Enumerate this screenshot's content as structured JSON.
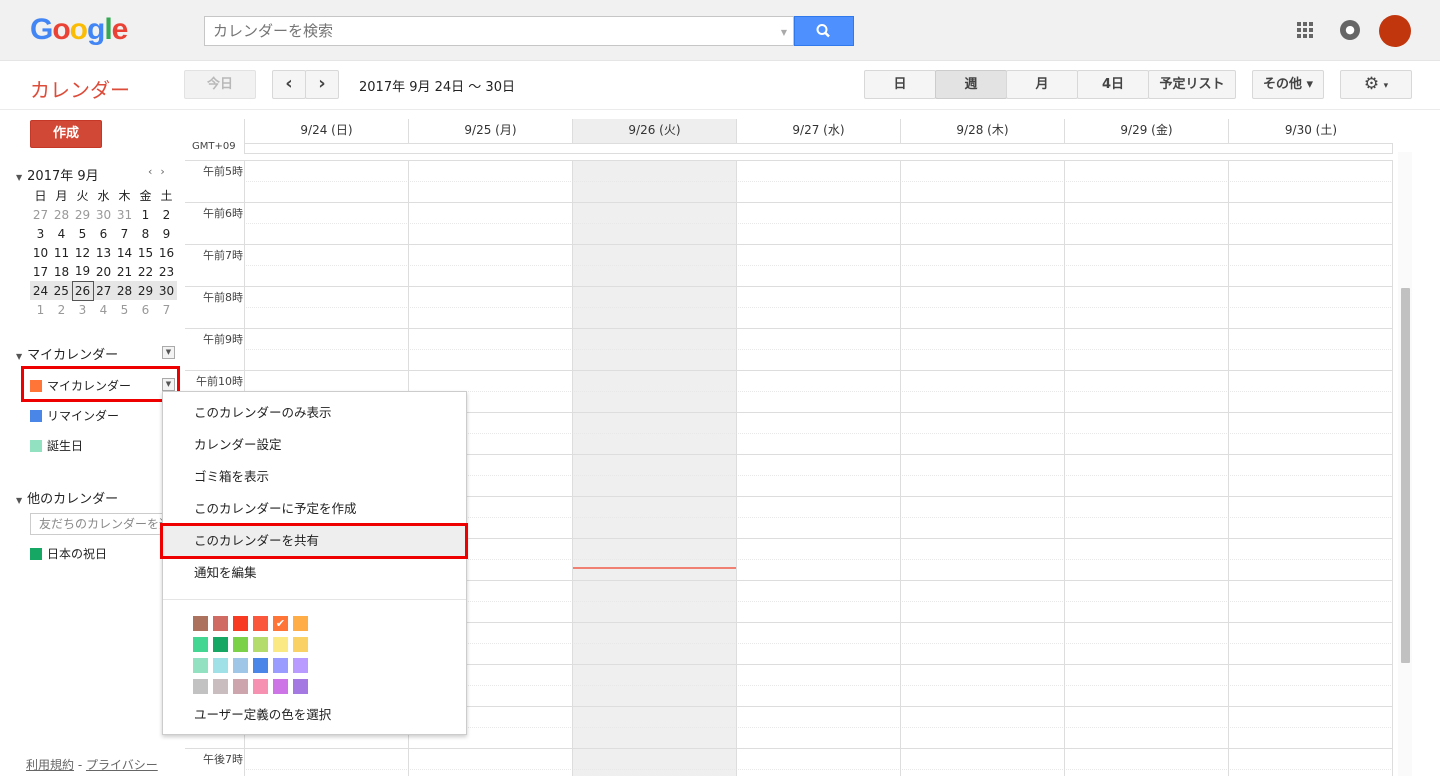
{
  "header": {
    "logo_letters": [
      "G",
      "o",
      "o",
      "g",
      "l",
      "e"
    ],
    "search_placeholder": "カレンダーを検索"
  },
  "toolbar": {
    "app_title": "カレンダー",
    "today_label": "今日",
    "prev_label": "‹",
    "next_label": "›",
    "date_range": "2017年 9月 24日 〜 30日",
    "views": [
      "日",
      "週",
      "月",
      "4日",
      "予定リスト"
    ],
    "active_view": "週",
    "more_label": "その他 ▾",
    "settings_label": "▾"
  },
  "sidebar": {
    "create_label": "作成",
    "mini_calendar": {
      "title": "2017年 9月",
      "weekdays": [
        "日",
        "月",
        "火",
        "水",
        "木",
        "金",
        "土"
      ],
      "weeks": [
        [
          "27",
          "28",
          "29",
          "30",
          "31",
          "1",
          "2"
        ],
        [
          "3",
          "4",
          "5",
          "6",
          "7",
          "8",
          "9"
        ],
        [
          "10",
          "11",
          "12",
          "13",
          "14",
          "15",
          "16"
        ],
        [
          "17",
          "18",
          "19",
          "20",
          "21",
          "22",
          "23"
        ],
        [
          "24",
          "25",
          "26",
          "27",
          "28",
          "29",
          "30"
        ],
        [
          "1",
          "2",
          "3",
          "4",
          "5",
          "6",
          "7"
        ]
      ],
      "today": "26"
    },
    "my_calendars_title": "マイカレンダー",
    "my_calendars": [
      {
        "label": "マイカレンダー",
        "color": "#ff7537"
      },
      {
        "label": "リマインダー",
        "color": "#4986e7"
      },
      {
        "label": "誕生日",
        "color": "#92e1c0"
      }
    ],
    "other_calendars_title": "他のカレンダー",
    "add_friend_placeholder": "友だちのカレンダーを追加",
    "other_calendars": [
      {
        "label": "日本の祝日",
        "color": "#16a765"
      }
    ],
    "footer_terms": "利用規約",
    "footer_sep": " - ",
    "footer_privacy": "プライバシー"
  },
  "week": {
    "timezone": "GMT+09",
    "days": [
      "9/24 (日)",
      "9/25 (月)",
      "9/26 (火)",
      "9/27 (水)",
      "9/28 (木)",
      "9/29 (金)",
      "9/30 (土)"
    ],
    "today_index": 2,
    "hours": [
      "午前5時",
      "午前6時",
      "午前7時",
      "午前8時",
      "午前9時",
      "午前10時"
    ],
    "bottom_hour": "午後7時"
  },
  "context_menu": {
    "items": [
      "このカレンダーのみ表示",
      "カレンダー設定",
      "ゴミ箱を表示",
      "このカレンダーに予定を作成",
      "このカレンダーを共有",
      "通知を編集"
    ],
    "highlighted_item": "このカレンダーを共有",
    "custom_color_label": "ユーザー定義の色を選択",
    "palette": [
      "#ac725e",
      "#d06b64",
      "#f83a22",
      "#fa573c",
      "#ff7537",
      "#ffad46",
      "#42d692",
      "#16a765",
      "#7bd148",
      "#b3dc6c",
      "#fbe983",
      "#fad165",
      "#92e1c0",
      "#9fe1e7",
      "#9fc6e7",
      "#4986e7",
      "#9a9cff",
      "#b99aff",
      "#c2c2c2",
      "#cabdbf",
      "#cca6ac",
      "#f691b2",
      "#cd74e6",
      "#a47ae2"
    ],
    "selected_color": "#ff7537"
  }
}
